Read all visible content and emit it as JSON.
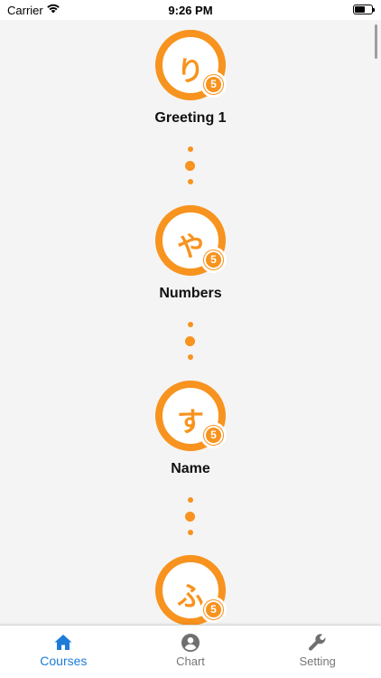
{
  "status_bar": {
    "carrier": "Carrier",
    "time": "9:26 PM"
  },
  "theme": {
    "accent": "#f7931e",
    "tab_active": "#1e7cd8",
    "tab_inactive": "#777777",
    "background": "#f4f4f4"
  },
  "lessons": [
    {
      "kana": "り",
      "level": "5",
      "title": "Greeting 1"
    },
    {
      "kana": "や",
      "level": "5",
      "title": "Numbers"
    },
    {
      "kana": "す",
      "level": "5",
      "title": "Name"
    },
    {
      "kana": "ふ",
      "level": "5",
      "title": ""
    }
  ],
  "tab_bar": {
    "items": [
      {
        "label": "Courses",
        "icon": "home-icon",
        "active": true
      },
      {
        "label": "Chart",
        "icon": "person-icon",
        "active": false
      },
      {
        "label": "Setting",
        "icon": "wrench-icon",
        "active": false
      }
    ]
  }
}
